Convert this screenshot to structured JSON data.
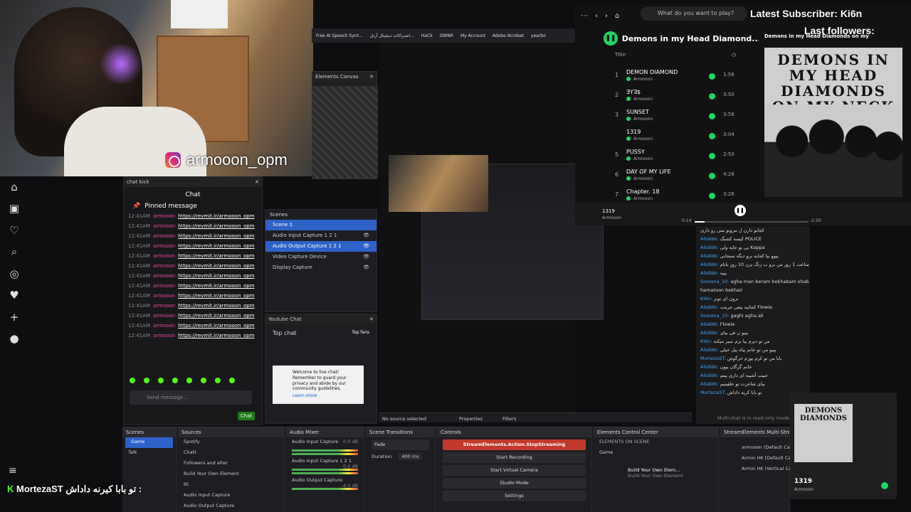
{
  "webcam": {
    "handle": "armooon_opm"
  },
  "chat_kick": {
    "panel_title": "chat kick",
    "header": "Chat",
    "pinned": "Pinned message",
    "lines": [
      {
        "ts": "12:41AM",
        "user": "armooon",
        "link": "https://revmit.ir/armooon_opm"
      },
      {
        "ts": "12:41AM",
        "user": "armooon",
        "link": "https://revmit.ir/armooon_opm"
      },
      {
        "ts": "12:41AM",
        "user": "armooon",
        "link": "https://revmit.ir/armooon_opm"
      },
      {
        "ts": "12:41AM",
        "user": "armooon",
        "link": "https://revmit.ir/armooon_opm"
      },
      {
        "ts": "12:41AM",
        "user": "armooon",
        "link": "https://revmit.ir/armooon_opm"
      },
      {
        "ts": "12:41AM",
        "user": "armooon",
        "link": "https://revmit.ir/armooon_opm"
      },
      {
        "ts": "12:41AM",
        "user": "armooon",
        "link": "https://revmit.ir/armooon_opm"
      },
      {
        "ts": "12:41AM",
        "user": "armooon",
        "link": "https://revmit.ir/armooon_opm"
      },
      {
        "ts": "12:41AM",
        "user": "armooon",
        "link": "https://revmit.ir/armooon_opm"
      },
      {
        "ts": "12:41AM",
        "user": "armooon",
        "link": "https://revmit.ir/armooon_opm"
      },
      {
        "ts": "12:41AM",
        "user": "armooon",
        "link": "https://revmit.ir/armooon_opm"
      },
      {
        "ts": "12:41AM",
        "user": "armooon",
        "link": "https://revmit.ir/armooon_opm"
      },
      {
        "ts": "12:41AM",
        "user": "armooon",
        "link": "https://revmit.ir/armooon_opm"
      }
    ],
    "input_placeholder": "Send message...",
    "send_label": "Chat"
  },
  "browser_bar": {
    "bookmarks": [
      "Free AI Speech Synt...",
      "اشتراکات دیجیتال آرتل...",
      "HaCk",
      "OWNR",
      "My Account",
      "Adobe Acrobat",
      "yearbo"
    ]
  },
  "elements_canvas": {
    "title": "Elements Canvas"
  },
  "scenes_panel": {
    "title": "Scenes",
    "items": [
      "Scene 1",
      "Audio Input Capture 1 2 1",
      "Audio Output Capture 1 2 1",
      "Video Capture Device",
      "Display Capture"
    ]
  },
  "yt_chat": {
    "title": "Youtube Chat",
    "mode": "Top chat",
    "fans": "Top fans",
    "notice": "Welcome to live chat! Remember to guard your privacy and abide by our community guidelines.",
    "learn_more": "Learn more"
  },
  "spotify": {
    "search_placeholder": "What do you want to play?",
    "latest_subscriber": "Latest Subscriber: Ki6n",
    "last_followers": "Last followers:",
    "playlist_title": "Demons in my Head Diamond...",
    "header_title": "Title",
    "album_top_text": "Demons in my Head Diamonds on my",
    "album_art_text": "DEMONS IN MY HEAD DIAMONDS ON MY NECK",
    "tracks": [
      {
        "num": "1",
        "name": "DEMON DIAMOND",
        "artist": "Armooon",
        "dur": "1:56"
      },
      {
        "num": "2",
        "name": "ƎY∃$",
        "artist": "Armooon",
        "dur": "3:50"
      },
      {
        "num": "3",
        "name": "SUNSET",
        "artist": "Armooon",
        "dur": "3:58"
      },
      {
        "num": "",
        "name": "1319",
        "artist": "Armooon",
        "dur": "3:04"
      },
      {
        "num": "5",
        "name": "PUSSY",
        "artist": "Armooon",
        "dur": "2:50"
      },
      {
        "num": "6",
        "name": "DAY OF MY LIFE",
        "artist": "Armooon",
        "dur": "4:28"
      },
      {
        "num": "7",
        "name": "Chapter. 18",
        "artist": "Armooon",
        "dur": "3:26"
      }
    ],
    "now_playing": {
      "track": "1319",
      "artist": "Armooon",
      "elapsed": "0:14",
      "remaining": "-2:50",
      "progress": 0.09
    }
  },
  "multichat": {
    "lines": [
      {
        "u": "",
        "t": "کجاتو دارن ل مرونو نمی رو داری"
      },
      {
        "u": "Alisbbk:",
        "t": "کپسه کشنگ POLICE"
      },
      {
        "u": "Alisbbk:",
        "t": "بی بو جایه ولی Kappa"
      },
      {
        "u": "Alisbbk:",
        "t": "پیوو بیا کجایه برو دیگه سبحانی"
      },
      {
        "u": "Alisbbk:",
        "t": "ساعت 1 روز من برو ب زنگ بزن 10 روز بابام"
      },
      {
        "u": "Alisbbk:",
        "t": "بیبه"
      },
      {
        "u": "Soorena_10:",
        "t": "agha man beram bokhabam shab"
      },
      {
        "u": "",
        "t": "hamatoon bekhair"
      },
      {
        "u": "Ki6n:",
        "t": "نرون ای نوبر"
      },
      {
        "u": "Alisbbk:",
        "t": "کجاتیه ببعی حرمت Flowie"
      },
      {
        "u": "Soorena_10:",
        "t": "gaghi agha ali"
      },
      {
        "u": "Alisbbk:",
        "t": "Flowie"
      },
      {
        "u": "Alisbbk:",
        "t": "بیبو ن فی بیای"
      },
      {
        "u": "Ki6n:",
        "t": "من تو دیرم بیا برم نمیر میکنه"
      },
      {
        "u": "Alisbbk:",
        "t": "پیبو من تو خانم پیاه پیل خیلی"
      },
      {
        "u": "MortezaST:",
        "t": "بابا من تو کرم یوزم خرگوش"
      },
      {
        "u": "Alisbbk:",
        "t": "خانم گرگان بیون"
      },
      {
        "u": "Alisbbk:",
        "t": "حییب آشیبه ای داری پیتم"
      },
      {
        "u": "Alisbbk:",
        "t": "بیای شاحرت تو خلقیتیم"
      },
      {
        "u": "MortezaST:",
        "t": "تو بابا کریه داداش"
      }
    ],
    "footer": "Multi-chat is in read-only mode"
  },
  "obs": {
    "scenes": {
      "title": "Scenes",
      "items": [
        "Game",
        "Talk"
      ]
    },
    "sources": {
      "title": "Sources",
      "items": [
        "Spotify",
        "Chatt",
        "Followers and alter",
        "Build Your Own Element",
        "IG",
        "Audio Input Capture",
        "Audio Output Capture"
      ]
    },
    "audio_mixer": {
      "title": "Audio Mixer",
      "ch1": "Audio Input Capture",
      "ch2": "Audio Input Capture 1 2 1",
      "ch3": "Audio Output Capture",
      "db1": "0.0 dB",
      "db2": "0.0 dB",
      "db3": "-4.0 dB"
    },
    "transitions": {
      "title": "Scene Transitions",
      "type": "Fade",
      "duration_label": "Duration",
      "duration": "400 ms"
    },
    "controls": {
      "title": "Controls",
      "stop": "StreamElements.Action.StopStreaming",
      "record": "Start Recording",
      "vcam": "Start Virtual Camera",
      "studio": "Studio Mode",
      "settings": "Settings"
    },
    "se_control": {
      "title": "Elements Control Center",
      "scene_label": "ELEMENTS ON SCENE",
      "scene_name": "Game",
      "el_name": "Build Your Own Elem...",
      "el_sub": "Build Your Own Element"
    },
    "se_multi": {
      "title": "StreamElements Multi-Strea...",
      "items": [
        "armooon (Default Canv...",
        "Armin HK (Default Canv...",
        "Armin HK (Vertical Can..."
      ]
    }
  },
  "status": {
    "no_source": "No source selected",
    "properties": "Properties",
    "filters": "Filters"
  },
  "bottom_chatter": {
    "name": "MortezaST",
    "text": "تو بابا کیرنه داداش :"
  },
  "np_widget": {
    "art_text": "DEMONS DIAMONDS",
    "track": "1319",
    "artist": "Armooon"
  }
}
